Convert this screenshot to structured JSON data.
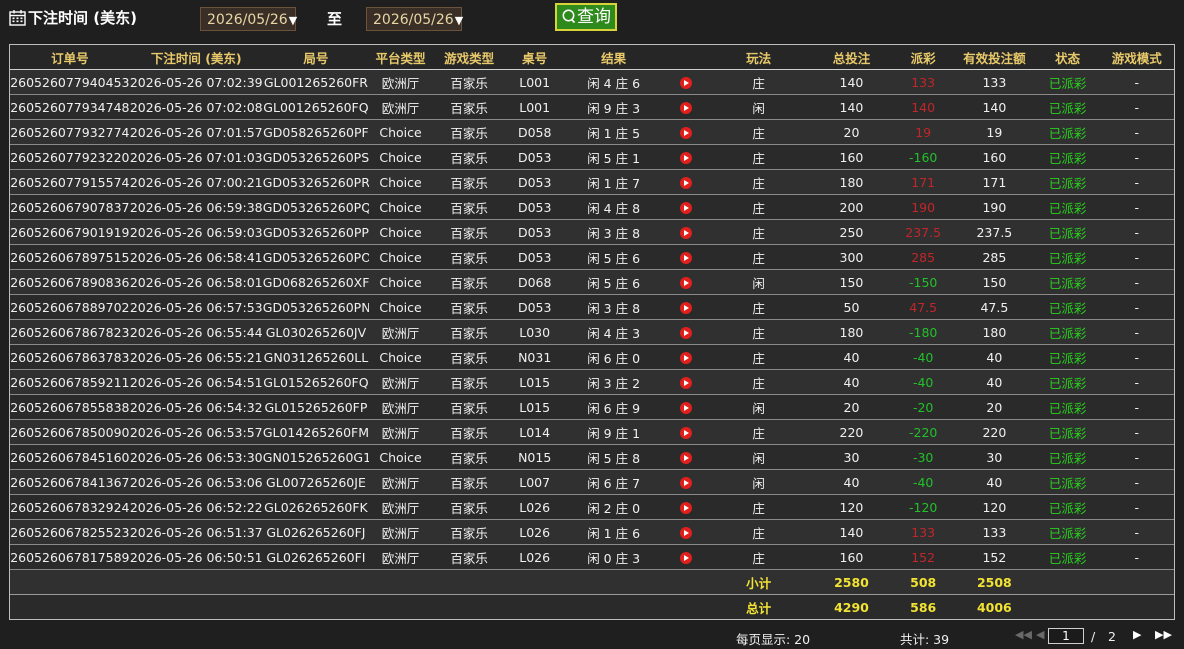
{
  "filter": {
    "label": "下注时间 (美东)",
    "start_date": "2026/05/26",
    "to_label": "至",
    "end_date": "2026/05/26",
    "query_label": "查询"
  },
  "columns": [
    "订单号",
    "下注时间 (美东)",
    "局号",
    "平台类型",
    "游戏类型",
    "桌号",
    "结果",
    "",
    "玩法",
    "总投注",
    "派彩",
    "有效投注额",
    "状态",
    "游戏模式"
  ],
  "rows": [
    {
      "order": "260526077940453",
      "time": "2026-05-26 07:02:39",
      "round": "GL001265260FR",
      "platform": "欧洲厅",
      "game": "百家乐",
      "table": "L001",
      "result": "闲 4 庄 6",
      "bet": "庄",
      "stake": "140",
      "payout": "133",
      "valid": "133",
      "status": "已派彩",
      "mode": "-"
    },
    {
      "order": "260526077934748",
      "time": "2026-05-26 07:02:08",
      "round": "GL001265260FQ",
      "platform": "欧洲厅",
      "game": "百家乐",
      "table": "L001",
      "result": "闲 9 庄 3",
      "bet": "闲",
      "stake": "140",
      "payout": "140",
      "valid": "140",
      "status": "已派彩",
      "mode": "-"
    },
    {
      "order": "260526077932774",
      "time": "2026-05-26 07:01:57",
      "round": "GD058265260PF",
      "platform": "Choice",
      "game": "百家乐",
      "table": "D058",
      "result": "闲 1 庄 5",
      "bet": "庄",
      "stake": "20",
      "payout": "19",
      "valid": "19",
      "status": "已派彩",
      "mode": "-"
    },
    {
      "order": "260526077923220",
      "time": "2026-05-26 07:01:03",
      "round": "GD053265260PS",
      "platform": "Choice",
      "game": "百家乐",
      "table": "D053",
      "result": "闲 5 庄 1",
      "bet": "庄",
      "stake": "160",
      "payout": "-160",
      "valid": "160",
      "status": "已派彩",
      "mode": "-"
    },
    {
      "order": "260526077915574",
      "time": "2026-05-26 07:00:21",
      "round": "GD053265260PR",
      "platform": "Choice",
      "game": "百家乐",
      "table": "D053",
      "result": "闲 1 庄 7",
      "bet": "庄",
      "stake": "180",
      "payout": "171",
      "valid": "171",
      "status": "已派彩",
      "mode": "-"
    },
    {
      "order": "260526067907837",
      "time": "2026-05-26 06:59:38",
      "round": "GD053265260PQ",
      "platform": "Choice",
      "game": "百家乐",
      "table": "D053",
      "result": "闲 4 庄 8",
      "bet": "庄",
      "stake": "200",
      "payout": "190",
      "valid": "190",
      "status": "已派彩",
      "mode": "-"
    },
    {
      "order": "260526067901919",
      "time": "2026-05-26 06:59:03",
      "round": "GD053265260PP",
      "platform": "Choice",
      "game": "百家乐",
      "table": "D053",
      "result": "闲 3 庄 8",
      "bet": "庄",
      "stake": "250",
      "payout": "237.5",
      "valid": "237.5",
      "status": "已派彩",
      "mode": "-"
    },
    {
      "order": "260526067897515",
      "time": "2026-05-26 06:58:41",
      "round": "GD053265260PO",
      "platform": "Choice",
      "game": "百家乐",
      "table": "D053",
      "result": "闲 5 庄 6",
      "bet": "庄",
      "stake": "300",
      "payout": "285",
      "valid": "285",
      "status": "已派彩",
      "mode": "-"
    },
    {
      "order": "260526067890836",
      "time": "2026-05-26 06:58:01",
      "round": "GD068265260XF",
      "platform": "Choice",
      "game": "百家乐",
      "table": "D068",
      "result": "闲 5 庄 6",
      "bet": "闲",
      "stake": "150",
      "payout": "-150",
      "valid": "150",
      "status": "已派彩",
      "mode": "-"
    },
    {
      "order": "260526067889702",
      "time": "2026-05-26 06:57:53",
      "round": "GD053265260PN",
      "platform": "Choice",
      "game": "百家乐",
      "table": "D053",
      "result": "闲 3 庄 8",
      "bet": "庄",
      "stake": "50",
      "payout": "47.5",
      "valid": "47.5",
      "status": "已派彩",
      "mode": "-"
    },
    {
      "order": "260526067867823",
      "time": "2026-05-26 06:55:44",
      "round": "GL030265260JV",
      "platform": "欧洲厅",
      "game": "百家乐",
      "table": "L030",
      "result": "闲 4 庄 3",
      "bet": "庄",
      "stake": "180",
      "payout": "-180",
      "valid": "180",
      "status": "已派彩",
      "mode": "-"
    },
    {
      "order": "260526067863783",
      "time": "2026-05-26 06:55:21",
      "round": "GN031265260LL",
      "platform": "Choice",
      "game": "百家乐",
      "table": "N031",
      "result": "闲 6 庄 0",
      "bet": "庄",
      "stake": "40",
      "payout": "-40",
      "valid": "40",
      "status": "已派彩",
      "mode": "-"
    },
    {
      "order": "260526067859211",
      "time": "2026-05-26 06:54:51",
      "round": "GL015265260FQ",
      "platform": "欧洲厅",
      "game": "百家乐",
      "table": "L015",
      "result": "闲 3 庄 2",
      "bet": "庄",
      "stake": "40",
      "payout": "-40",
      "valid": "40",
      "status": "已派彩",
      "mode": "-"
    },
    {
      "order": "260526067855838",
      "time": "2026-05-26 06:54:32",
      "round": "GL015265260FP",
      "platform": "欧洲厅",
      "game": "百家乐",
      "table": "L015",
      "result": "闲 6 庄 9",
      "bet": "闲",
      "stake": "20",
      "payout": "-20",
      "valid": "20",
      "status": "已派彩",
      "mode": "-"
    },
    {
      "order": "260526067850090",
      "time": "2026-05-26 06:53:57",
      "round": "GL014265260FM",
      "platform": "欧洲厅",
      "game": "百家乐",
      "table": "L014",
      "result": "闲 9 庄 1",
      "bet": "庄",
      "stake": "220",
      "payout": "-220",
      "valid": "220",
      "status": "已派彩",
      "mode": "-"
    },
    {
      "order": "260526067845160",
      "time": "2026-05-26 06:53:30",
      "round": "GN015265260G1",
      "platform": "Choice",
      "game": "百家乐",
      "table": "N015",
      "result": "闲 5 庄 8",
      "bet": "闲",
      "stake": "30",
      "payout": "-30",
      "valid": "30",
      "status": "已派彩",
      "mode": "-"
    },
    {
      "order": "260526067841367",
      "time": "2026-05-26 06:53:06",
      "round": "GL007265260JE",
      "platform": "欧洲厅",
      "game": "百家乐",
      "table": "L007",
      "result": "闲 6 庄 7",
      "bet": "闲",
      "stake": "40",
      "payout": "-40",
      "valid": "40",
      "status": "已派彩",
      "mode": "-"
    },
    {
      "order": "260526067832924",
      "time": "2026-05-26 06:52:22",
      "round": "GL026265260FK",
      "platform": "欧洲厅",
      "game": "百家乐",
      "table": "L026",
      "result": "闲 2 庄 0",
      "bet": "庄",
      "stake": "120",
      "payout": "-120",
      "valid": "120",
      "status": "已派彩",
      "mode": "-"
    },
    {
      "order": "260526067825523",
      "time": "2026-05-26 06:51:37",
      "round": "GL026265260FJ",
      "platform": "欧洲厅",
      "game": "百家乐",
      "table": "L026",
      "result": "闲 1 庄 6",
      "bet": "庄",
      "stake": "140",
      "payout": "133",
      "valid": "133",
      "status": "已派彩",
      "mode": "-"
    },
    {
      "order": "260526067817589",
      "time": "2026-05-26 06:50:51",
      "round": "GL026265260FI",
      "platform": "欧洲厅",
      "game": "百家乐",
      "table": "L026",
      "result": "闲 0 庄 3",
      "bet": "庄",
      "stake": "160",
      "payout": "152",
      "valid": "152",
      "status": "已派彩",
      "mode": "-"
    }
  ],
  "subtotal": {
    "label": "小计",
    "stake": "2580",
    "payout": "508",
    "valid": "2508"
  },
  "total": {
    "label": "总计",
    "stake": "4290",
    "payout": "586",
    "valid": "4006"
  },
  "pager": {
    "per_page": "每页显示: 20",
    "total_count": "共计: 39",
    "current_page": "1",
    "slash": "/",
    "total_pages": "2"
  },
  "colors": {
    "payout_win": "#c0262a",
    "payout_loss": "#22c02a",
    "status": "#2ad11e",
    "header_text": "#e8c96a",
    "summary_text": "#f2e332",
    "query_button": "#2f8a1d"
  },
  "icons": {
    "filter": "calendar-icon",
    "query": "search-icon",
    "row_action": "play-icon"
  }
}
